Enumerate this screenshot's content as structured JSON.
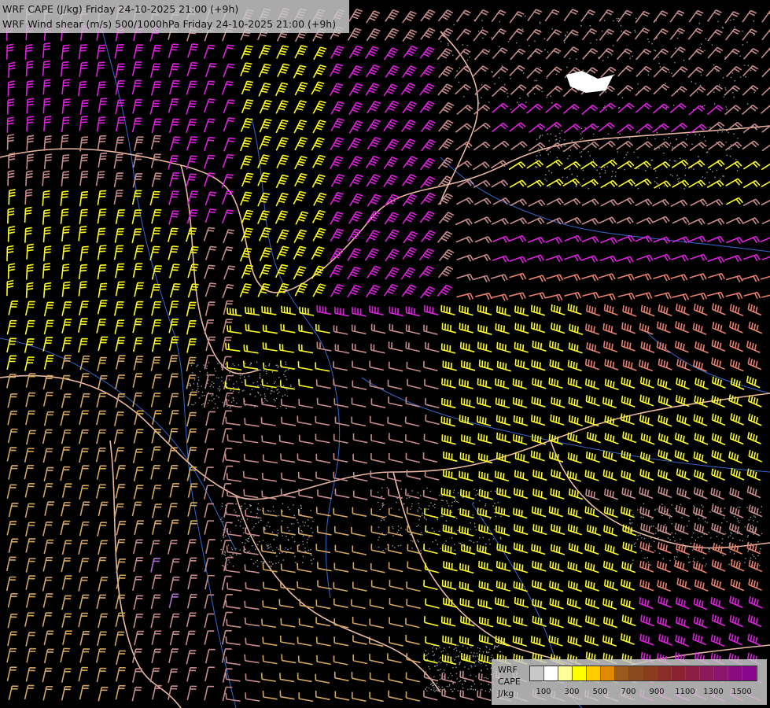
{
  "header": {
    "line1": "WRF CAPE (J/kg) Friday 24-10-2025 21:00 (+9h)",
    "line2": "WRF Wind shear (m/s) 500/1000hPa Friday 24-10-2025 21:00 (+9h)"
  },
  "legend": {
    "label_top": "WRF",
    "label_mid": "CAPE",
    "label_unit": "J/kg",
    "colors": [
      "#c8c8c8",
      "#ffffff",
      "#ffff99",
      "#ffff00",
      "#ffcc00",
      "#e08a00",
      "#9a5a1e",
      "#8a4a1e",
      "#8a3c1e",
      "#8a2d28",
      "#8a2232",
      "#8c1e46",
      "#8c1a5a",
      "#8a146e",
      "#880c80",
      "#86068c"
    ],
    "ticks": [
      "100",
      "300",
      "500",
      "700",
      "900",
      "1100",
      "1300",
      "1500"
    ]
  },
  "map": {
    "barb_colors": {
      "magenta": "#e020e0",
      "yellow": "#ffff20",
      "salmon": "#e8806e",
      "tan": "#d4a860",
      "pink": "#c88c8c",
      "violet": "#b070d0"
    },
    "border_color": "#e8b8a0",
    "river_color": "#3060c0",
    "snow_color": "#ffffff"
  }
}
